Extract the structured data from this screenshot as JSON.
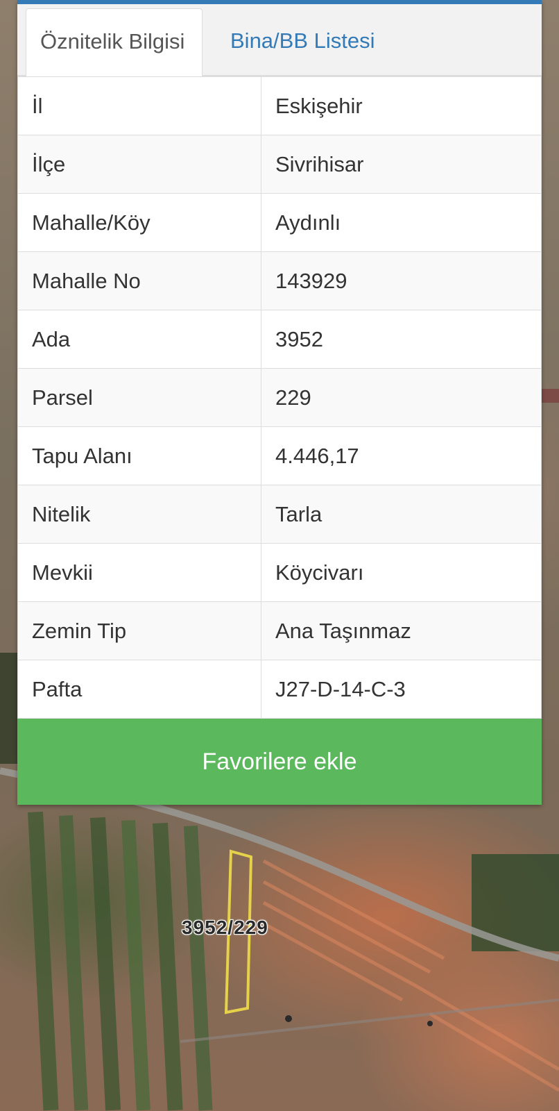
{
  "tabs": [
    {
      "label": "Öznitelik Bilgisi",
      "active": true
    },
    {
      "label": "Bina/BB Listesi",
      "active": false
    }
  ],
  "attributes": [
    {
      "key": "İl",
      "value": "Eskişehir"
    },
    {
      "key": "İlçe",
      "value": "Sivrihisar"
    },
    {
      "key": "Mahalle/Köy",
      "value": "Aydınlı"
    },
    {
      "key": "Mahalle No",
      "value": "143929"
    },
    {
      "key": "Ada",
      "value": "3952"
    },
    {
      "key": "Parsel",
      "value": "229"
    },
    {
      "key": "Tapu Alanı",
      "value": "4.446,17"
    },
    {
      "key": "Nitelik",
      "value": "Tarla"
    },
    {
      "key": "Mevkii",
      "value": "Köycivarı"
    },
    {
      "key": "Zemin Tip",
      "value": "Ana Taşınmaz"
    },
    {
      "key": "Pafta",
      "value": "J27-D-14-C-3"
    }
  ],
  "actions": {
    "favorite_label": "Favorilere ekle"
  },
  "map": {
    "parcel_label": "3952/229"
  },
  "colors": {
    "accent": "#337ab7",
    "button": "#5cb85c",
    "parcel_outline": "#e6d24a"
  }
}
